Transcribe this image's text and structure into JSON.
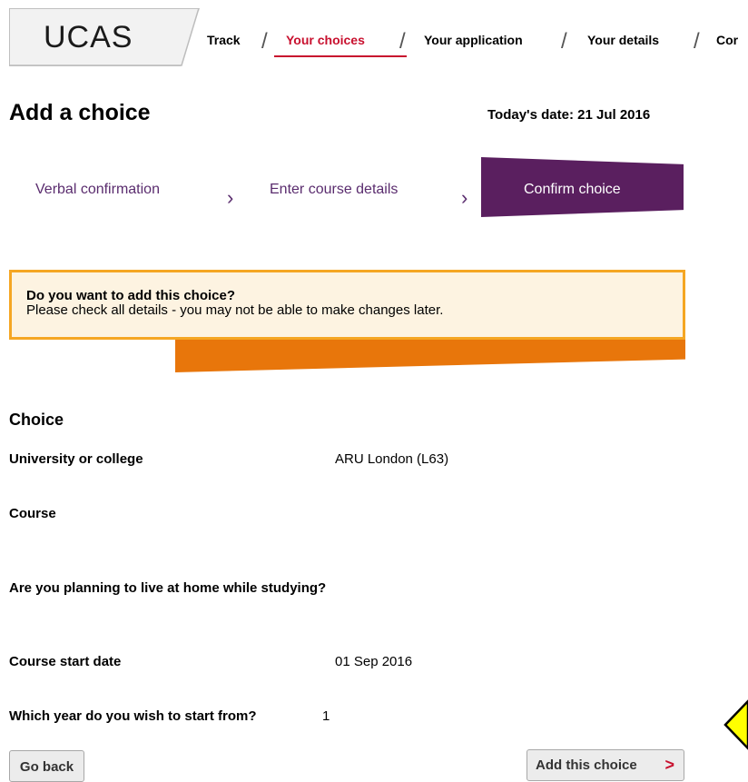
{
  "header": {
    "logo": "UCAS",
    "nav": [
      {
        "label": "Track",
        "active": false
      },
      {
        "label": "Your choices",
        "active": true
      },
      {
        "label": "Your application",
        "active": false
      },
      {
        "label": "Your details",
        "active": false
      },
      {
        "label": "Cor",
        "active": false
      }
    ]
  },
  "page": {
    "title": "Add a choice",
    "today": "Today's date: 21 Jul 2016"
  },
  "steps": [
    {
      "label": "Verbal confirmation",
      "active": false
    },
    {
      "label": "Enter course details",
      "active": false
    },
    {
      "label": "Confirm choice",
      "active": true
    }
  ],
  "alert": {
    "title": "Do you want to add this choice?",
    "body": "Please check all details - you may not be able to make changes later."
  },
  "choice": {
    "heading": "Choice",
    "rows": [
      {
        "label": "University or college",
        "value": "ARU London (L63)"
      },
      {
        "label": "Course",
        "value": ""
      },
      {
        "label": "Are you planning to live at home while studying?",
        "value": ""
      },
      {
        "label": "Course start date",
        "value": "01 Sep 2016"
      },
      {
        "label": "Which year do you wish to start from?",
        "value": "1"
      }
    ]
  },
  "actions": {
    "back": "Go back",
    "add": "Add this choice",
    "add_arrow": ">"
  },
  "colors": {
    "accent": "#c8102e",
    "purple": "#5a1f5f",
    "alert_border": "#f5a623",
    "alert_bar": "#e8760b",
    "help_tab": "#ffff00"
  }
}
